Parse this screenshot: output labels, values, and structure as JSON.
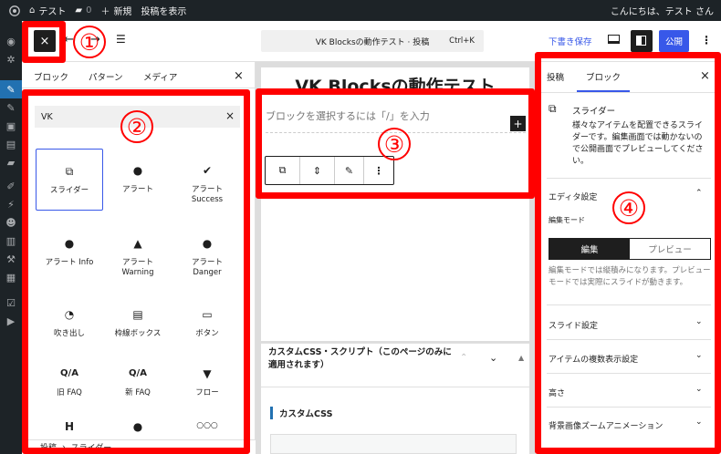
{
  "adminbar": {
    "site": "テスト",
    "comments": "0",
    "new": "新規",
    "view": "投稿を表示",
    "greeting": "こんにちは、テスト さん"
  },
  "header": {
    "close": "×",
    "search_title": "VK Blocksの動作テスト · 投稿",
    "shortcut": "Ctrl+K",
    "draft": "下書き保存",
    "publish": "公開",
    "more": "⋮"
  },
  "inserter": {
    "tabs": [
      "ブロック",
      "パターン",
      "メディア"
    ],
    "close": "×",
    "search_value": "VK",
    "blocks": [
      {
        "label": "スライダー",
        "icon": "slider-icon"
      },
      {
        "label": "アラート",
        "icon": "alert-icon"
      },
      {
        "label": "アラート Success",
        "icon": "alert-success-icon"
      },
      {
        "label": "アラート Info",
        "icon": "alert-info-icon"
      },
      {
        "label": "アラート Warning",
        "icon": "alert-warning-icon"
      },
      {
        "label": "アラート Danger",
        "icon": "alert-danger-icon"
      },
      {
        "label": "吹き出し",
        "icon": "balloon-icon"
      },
      {
        "label": "枠線ボックス",
        "icon": "border-box-icon"
      },
      {
        "label": "ボタン",
        "icon": "button-icon"
      },
      {
        "label": "旧 FAQ",
        "icon": "faq-old-icon"
      },
      {
        "label": "新 FAQ",
        "icon": "faq-new-icon"
      },
      {
        "label": "フロー",
        "icon": "flow-icon"
      },
      {
        "label": "",
        "icon": "heading-icon"
      },
      {
        "label": "",
        "icon": "info-icon"
      },
      {
        "label": "",
        "icon": "dots-icon"
      }
    ],
    "breadcrumb": [
      "投稿",
      "スライダー"
    ]
  },
  "canvas": {
    "title": "VK Blocksの動作テスト",
    "placeholder": "ブロックを選択するには「/」を入力",
    "plus": "+",
    "meta_title": "カスタムCSS・スクリプト（このページのみに適用されます）",
    "css_label": "カスタムCSS"
  },
  "sidebar": {
    "tabs": [
      "投稿",
      "ブロック"
    ],
    "close": "×",
    "block_name": "スライダー",
    "block_desc": "様々なアイテムを配置できるスライダーです。編集画面では動かないので公開画面でプレビューしてください。",
    "editor_settings": "エディタ設定",
    "edit_mode": "編集モード",
    "mode_edit": "編集",
    "mode_preview": "プレビュー",
    "help": "編集モードでは縦積みになります。プレビューモードでは実際にスライドが動きます。",
    "sections": [
      "スライド設定",
      "アイテムの複数表示設定",
      "高さ",
      "背景画像ズームアニメーション"
    ]
  },
  "annotations": [
    "①",
    "②",
    "③",
    "④"
  ]
}
